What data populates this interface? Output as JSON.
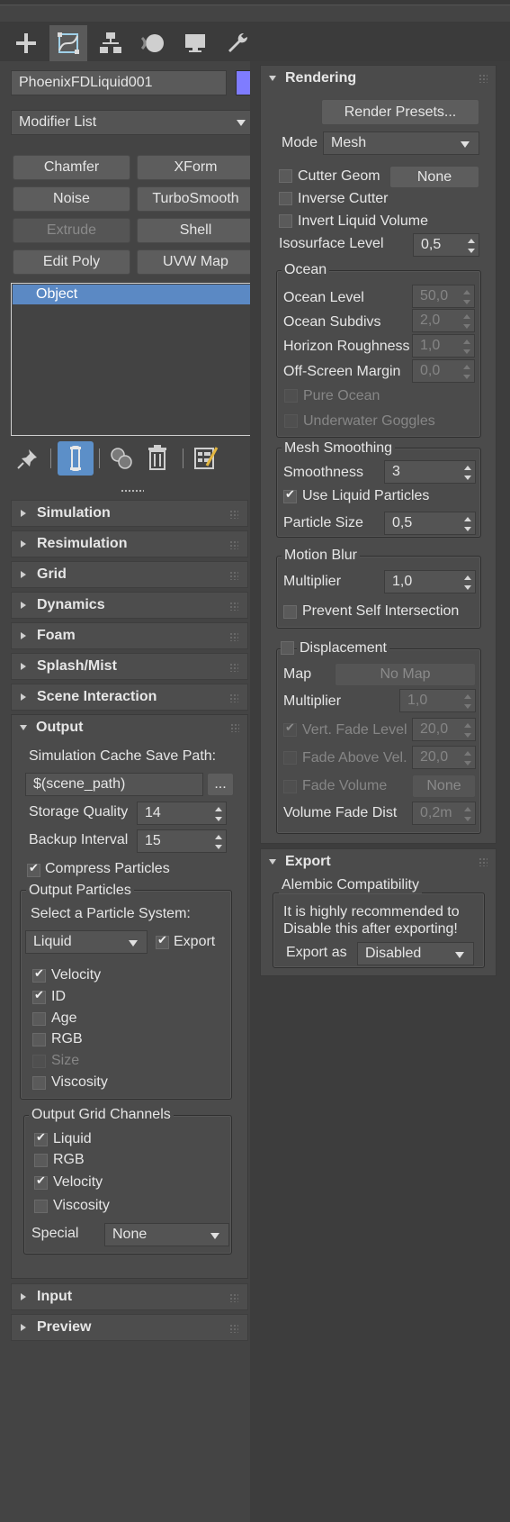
{
  "colors": {
    "background": "#444444",
    "selection": "#5b89c4",
    "object_color_swatch": "#7f7cff",
    "active_tab": "#5a5a5a"
  },
  "command_tabs": [
    {
      "name": "create",
      "icon": "plus-icon"
    },
    {
      "name": "modify",
      "icon": "modify-curve-icon",
      "active": true
    },
    {
      "name": "hierarchy",
      "icon": "hierarchy-icon"
    },
    {
      "name": "motion",
      "icon": "motion-icon"
    },
    {
      "name": "display",
      "icon": "display-monitor-icon"
    },
    {
      "name": "utilities",
      "icon": "wrench-icon"
    }
  ],
  "object_name": "PhoenixFDLiquid001",
  "modifier_list_label": "Modifier List",
  "modifier_buttons": {
    "chamfer": "Chamfer",
    "xform": "XForm",
    "noise": "Noise",
    "turbosmooth": "TurboSmooth",
    "extrude": "Extrude",
    "shell": "Shell",
    "edit_poly": "Edit Poly",
    "uvw_map": "UVW Map"
  },
  "modifier_stack": {
    "items": [
      "Object"
    ]
  },
  "stack_tools": [
    "pin-stack-icon",
    "show-end-result-icon",
    "make-unique-icon",
    "remove-modifier-icon",
    "configure-modifier-sets-icon"
  ],
  "left_rollouts": {
    "simulation": "Simulation",
    "resimulation": "Resimulation",
    "grid": "Grid",
    "dynamics": "Dynamics",
    "foam": "Foam",
    "splash_mist": "Splash/Mist",
    "scene_interaction": "Scene Interaction",
    "output": "Output",
    "input": "Input",
    "preview": "Preview"
  },
  "output": {
    "cache_path_label": "Simulation Cache Save Path:",
    "cache_path_value": "$(scene_path)",
    "browse_label": "...",
    "storage_quality_label": "Storage Quality",
    "storage_quality_value": "14",
    "backup_interval_label": "Backup Interval",
    "backup_interval_value": "15",
    "compress_particles_label": "Compress Particles",
    "compress_particles_checked": true,
    "output_particles": {
      "title": "Output Particles",
      "select_label": "Select a Particle System:",
      "system_value": "Liquid",
      "export_label": "Export",
      "export_checked": true,
      "channels": [
        {
          "label": "Velocity",
          "checked": true,
          "enabled": true
        },
        {
          "label": "ID",
          "checked": true,
          "enabled": true
        },
        {
          "label": "Age",
          "checked": false,
          "enabled": true
        },
        {
          "label": "RGB",
          "checked": false,
          "enabled": true
        },
        {
          "label": "Size",
          "checked": false,
          "enabled": false
        },
        {
          "label": "Viscosity",
          "checked": false,
          "enabled": true
        }
      ]
    },
    "output_grid_channels": {
      "title": "Output Grid Channels",
      "channels": [
        {
          "label": "Liquid",
          "checked": true
        },
        {
          "label": "RGB",
          "checked": false
        },
        {
          "label": "Velocity",
          "checked": true
        },
        {
          "label": "Viscosity",
          "checked": false
        }
      ],
      "special_label": "Special",
      "special_value": "None"
    }
  },
  "rendering": {
    "title": "Rendering",
    "render_presets_label": "Render Presets...",
    "mode_label": "Mode",
    "mode_value": "Mesh",
    "cutter_geom_label": "Cutter Geom",
    "cutter_geom_value": "None",
    "inverse_cutter_label": "Inverse Cutter",
    "invert_liquid_volume_label": "Invert Liquid Volume",
    "isosurface_label": "Isosurface Level",
    "isosurface_value": "0,5",
    "ocean": {
      "title": "Ocean",
      "ocean_level_label": "Ocean Level",
      "ocean_level_value": "50,0",
      "ocean_subdivs_label": "Ocean Subdivs",
      "ocean_subdivs_value": "2,0",
      "horizon_roughness_label": "Horizon Roughness",
      "horizon_roughness_value": "1,0",
      "off_screen_margin_label": "Off-Screen Margin",
      "off_screen_margin_value": "0,0",
      "pure_ocean_label": "Pure Ocean",
      "underwater_goggles_label": "Underwater Goggles"
    },
    "mesh_smoothing": {
      "title": "Mesh Smoothing",
      "smoothness_label": "Smoothness",
      "smoothness_value": "3",
      "use_liquid_particles_label": "Use Liquid Particles",
      "use_liquid_particles_checked": true,
      "particle_size_label": "Particle Size",
      "particle_size_value": "0,5"
    },
    "motion_blur": {
      "title": "Motion Blur",
      "multiplier_label": "Multiplier",
      "multiplier_value": "1,0",
      "prevent_self_intersection_label": "Prevent Self Intersection"
    },
    "displacement": {
      "title": "Displacement",
      "map_label": "Map",
      "map_value": "No Map",
      "multiplier_label": "Multiplier",
      "multiplier_value": "1,0",
      "vert_fade_level_label": "Vert. Fade Level",
      "vert_fade_level_value": "20,0",
      "fade_above_vel_label": "Fade Above Vel.",
      "fade_above_vel_value": "20,0",
      "fade_volume_label": "Fade Volume",
      "fade_volume_value": "None",
      "volume_fade_dist_label": "Volume Fade Dist",
      "volume_fade_dist_value": "0,2m"
    }
  },
  "export": {
    "title": "Export",
    "alembic_title": "Alembic Compatibility",
    "note_line1": "It is highly recommended to",
    "note_line2": "Disable this after exporting!",
    "export_as_label": "Export as",
    "export_as_value": "Disabled"
  }
}
